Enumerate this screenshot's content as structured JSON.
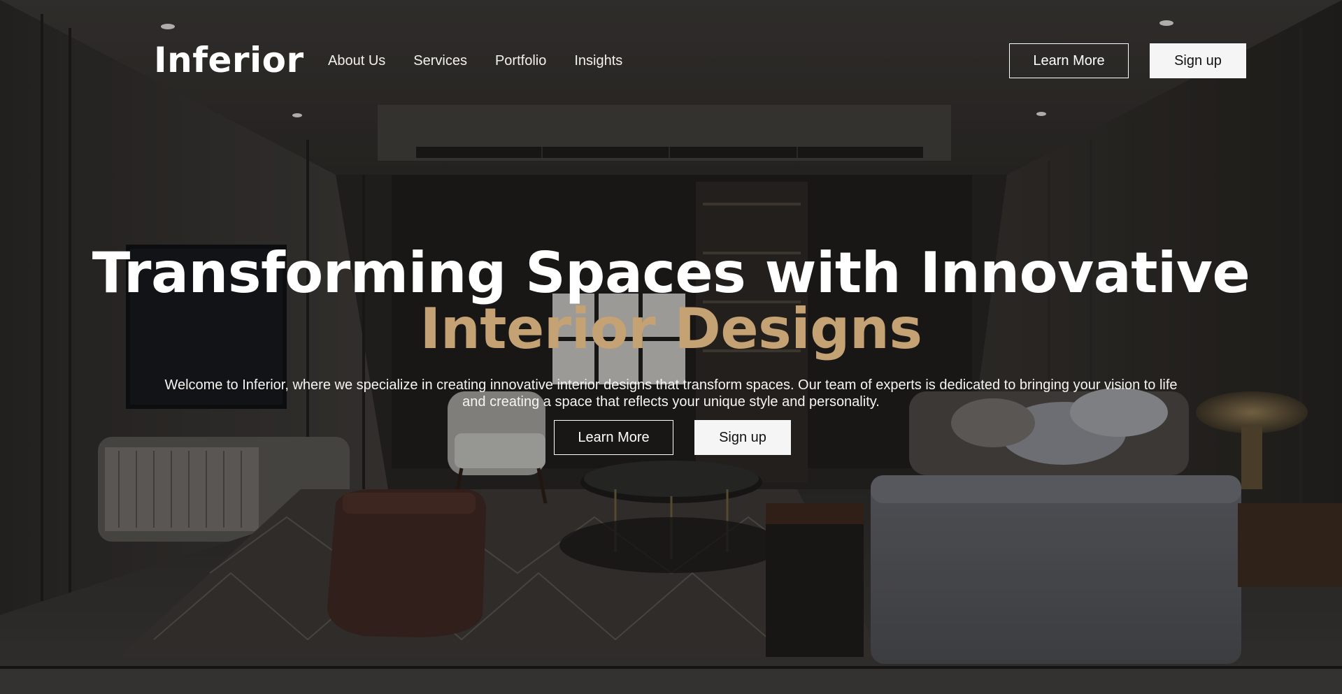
{
  "brand": {
    "name": "Inferior"
  },
  "nav": {
    "links": [
      "About Us",
      "Services",
      "Portfolio",
      "Insights"
    ],
    "learn_more": "Learn More",
    "sign_up": "Sign up"
  },
  "hero": {
    "title_line1": "Transforming Spaces with Innovative",
    "title_line2": "Interior Designs",
    "subtitle": "Welcome to Inferior, where we specialize in creating innovative interior designs that transform spaces. Our team of experts is dedicated to bringing your vision to life and creating a space that reflects your unique style and personality.",
    "learn_more": "Learn More",
    "sign_up": "Sign up"
  },
  "colors": {
    "accent": "#c4a274",
    "text": "#ffffff",
    "button_fill": "#f5f5f5"
  }
}
